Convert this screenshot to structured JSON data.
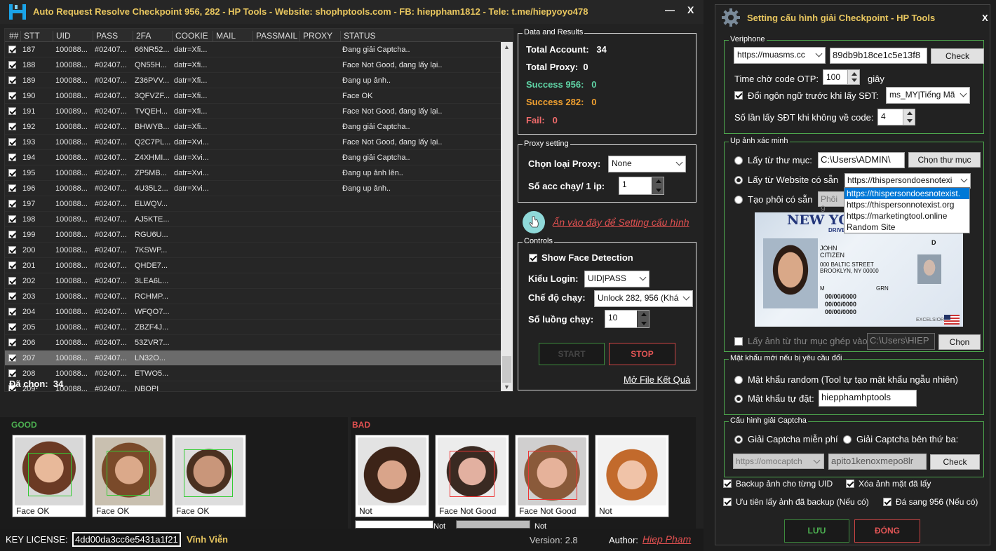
{
  "window": {
    "title": "Auto Request Resolve Checkpoint 956, 282 - HP Tools - Website: shophptools.com - FB: hieppham1812 - Tele: t.me/hiepyoyo478",
    "minimize": "—",
    "close": "X"
  },
  "grid": {
    "columns": [
      "##",
      "STT",
      "UID",
      "PASS",
      "2FA",
      "COOKIE",
      "MAIL",
      "PASSMAIL",
      "PROXY",
      "STATUS"
    ],
    "rows": [
      {
        "stt": "187",
        "uid": "100088...",
        "pass": "#02407...",
        "fa": "66NR52...",
        "cookie": "datr=Xfi...",
        "status": "Đang giải Captcha..",
        "checked": true
      },
      {
        "stt": "188",
        "uid": "100088...",
        "pass": "#02407...",
        "fa": "QN55H...",
        "cookie": "datr=Xfi...",
        "status": "Face Not Good, đang lấy lại..",
        "checked": true
      },
      {
        "stt": "189",
        "uid": "100088...",
        "pass": "#02407...",
        "fa": "Z36PVV...",
        "cookie": "datr=Xfi...",
        "status": "Đang up ảnh..",
        "checked": true
      },
      {
        "stt": "190",
        "uid": "100088...",
        "pass": "#02407...",
        "fa": "3QFVZF...",
        "cookie": "datr=Xfi...",
        "status": "Face OK",
        "checked": true
      },
      {
        "stt": "191",
        "uid": "100089...",
        "pass": "#02407...",
        "fa": "TVQEH...",
        "cookie": "datr=Xfi...",
        "status": "Face Not Good, đang lấy lại..",
        "checked": true
      },
      {
        "stt": "192",
        "uid": "100088...",
        "pass": "#02407...",
        "fa": "BHWYB...",
        "cookie": "datr=Xfi...",
        "status": "Đang giải Captcha..",
        "checked": true
      },
      {
        "stt": "193",
        "uid": "100088...",
        "pass": "#02407...",
        "fa": "Q2C7PL...",
        "cookie": "datr=Xvi...",
        "status": "Face Not Good, đang lấy lại..",
        "checked": true
      },
      {
        "stt": "194",
        "uid": "100088...",
        "pass": "#02407...",
        "fa": "Z4XHMI...",
        "cookie": "datr=Xvi...",
        "status": "Đang giải Captcha..",
        "checked": true
      },
      {
        "stt": "195",
        "uid": "100088...",
        "pass": "#02407...",
        "fa": "ZP5MB...",
        "cookie": "datr=Xvi...",
        "status": "Đang up ảnh lên..",
        "checked": true
      },
      {
        "stt": "196",
        "uid": "100088...",
        "pass": "#02407...",
        "fa": "4U35L2...",
        "cookie": "datr=Xvi...",
        "status": "Đang up ảnh..",
        "checked": true
      },
      {
        "stt": "197",
        "uid": "100088...",
        "pass": "#02407...",
        "fa": "ELWQV...",
        "cookie": "",
        "status": "",
        "checked": true
      },
      {
        "stt": "198",
        "uid": "100089...",
        "pass": "#02407...",
        "fa": "AJ5KTE...",
        "cookie": "",
        "status": "",
        "checked": true
      },
      {
        "stt": "199",
        "uid": "100088...",
        "pass": "#02407...",
        "fa": "RGU6U...",
        "cookie": "",
        "status": "",
        "checked": true
      },
      {
        "stt": "200",
        "uid": "100088...",
        "pass": "#02407...",
        "fa": "7KSWP...",
        "cookie": "",
        "status": "",
        "checked": true
      },
      {
        "stt": "201",
        "uid": "100088...",
        "pass": "#02407...",
        "fa": "QHDE7...",
        "cookie": "",
        "status": "",
        "checked": true
      },
      {
        "stt": "202",
        "uid": "100088...",
        "pass": "#02407...",
        "fa": "3LEA6L...",
        "cookie": "",
        "status": "",
        "checked": true
      },
      {
        "stt": "203",
        "uid": "100088...",
        "pass": "#02407...",
        "fa": "RCHMP...",
        "cookie": "",
        "status": "",
        "checked": true
      },
      {
        "stt": "204",
        "uid": "100088...",
        "pass": "#02407...",
        "fa": "WFQO7...",
        "cookie": "",
        "status": "",
        "checked": true
      },
      {
        "stt": "205",
        "uid": "100088...",
        "pass": "#02407...",
        "fa": "ZBZF4J...",
        "cookie": "",
        "status": "",
        "checked": true
      },
      {
        "stt": "206",
        "uid": "100088...",
        "pass": "#02407...",
        "fa": "53ZVR7...",
        "cookie": "",
        "status": "",
        "checked": true
      },
      {
        "stt": "207",
        "uid": "100088...",
        "pass": "#02407...",
        "fa": "LN32O...",
        "cookie": "",
        "status": "",
        "checked": true,
        "selected": true
      },
      {
        "stt": "208",
        "uid": "100088...",
        "pass": "#02407...",
        "fa": "ETWO5...",
        "cookie": "",
        "status": "",
        "checked": true
      },
      {
        "stt": "209",
        "uid": "100088...",
        "pass": "#02407...",
        "fa": "NBOPI",
        "cookie": "",
        "status": "",
        "checked": true
      }
    ],
    "selected_count_label": "Đã chọn:",
    "selected_count": "34"
  },
  "results": {
    "legend": "Data and Results",
    "total_account_label": "Total Account:",
    "total_account": "34",
    "total_proxy_label": "Total Proxy:",
    "total_proxy": "0",
    "success956_label": "Success 956:",
    "success956": "0",
    "success282_label": "Success 282:",
    "success282": "0",
    "fail_label": "Fail:",
    "fail": "0",
    "colors": {
      "success956": "#5fd3a5",
      "success282": "#f0a030",
      "fail": "#f06b6b"
    }
  },
  "proxy": {
    "legend": "Proxy setting",
    "type_label": "Chọn loại Proxy:",
    "type_value": "None",
    "per_ip_label": "Số acc chạy/ 1 ip:",
    "per_ip_value": "1"
  },
  "settings_link": "Ấn vào đây để Setting cấu hình",
  "controls": {
    "legend": "Controls",
    "show_face": "Show Face Detection",
    "login_label": "Kiểu Login:",
    "login_value": "UID|PASS",
    "mode_label": "Chế độ chạy:",
    "mode_value": "Unlock 282, 956 (Khá",
    "threads_label": "Số luồng chạy:",
    "threads_value": "10",
    "start": "START",
    "stop": "STOP",
    "open_file": "Mở File Kết Quả"
  },
  "faces": {
    "good_label": "GOOD",
    "bad_label": "BAD",
    "good": [
      "Face OK",
      "Face OK",
      "Face OK"
    ],
    "bad": [
      "Not",
      "Face Not Good",
      "Face Not Good",
      "Not"
    ],
    "extra": [
      "Not",
      "Not"
    ]
  },
  "footer": {
    "key_label": "KEY LICENSE:",
    "key_value": "4dd00da3cc6e5431a1f21",
    "license_type": "Vĩnh Viễn",
    "version": "Version: 2.8",
    "author_label": "Author:",
    "author": "Hiep Pham"
  },
  "config": {
    "title": "Setting cấu hình giải Checkpoint - HP Tools",
    "close": "X",
    "veriphone": {
      "legend": "Veriphone",
      "site": "https://muasms.cc",
      "key": "89db9b18ce1c5e13f8",
      "check": "Check",
      "otp_wait_label": "Time chờ code OTP:",
      "otp_wait": "100",
      "otp_unit": "giây",
      "change_lang_label": "Đổi ngôn ngữ trước khi lấy SĐT:",
      "lang": "ms_MY|Tiếng Mã",
      "retry_label": "Số lần lấy SĐT khi không về code:",
      "retry": "4"
    },
    "upload": {
      "legend": "Up ảnh xác minh",
      "from_folder": "Lấy từ thư mục:",
      "folder_path": "C:\\Users\\ADMIN\\",
      "choose_folder": "Chọn thư mục",
      "from_website": "Lấy từ Website có sẵn",
      "website": "https://thispersondoesnotexi",
      "options": [
        "https://thispersondoesnotexist.",
        "https://thispersonnotexist.org",
        "https://marketingtool.online",
        "Random Site"
      ],
      "template_label": "Tạo phôi có sẵn",
      "template_value": "Phôi 9",
      "merge_label": "Lấy ảnh từ thư mục ghép vào:",
      "merge_path": "C:\\Users\\HIEP",
      "choose": "Chọn"
    },
    "id_card": {
      "header": "NEW YO",
      "sub": "DRIVE",
      "name1": "JOHN",
      "name2": "CITIZEN",
      "addr1": "000 BALTIC STREET",
      "addr2": "BROOKLYN, NY 00000",
      "cls": "D",
      "dob": "00/00/0000",
      "exp": "00/00/0000",
      "iss": "00/00/0000",
      "eyes": "GRN",
      "sex": "M",
      "foot": "EXCELSIOR"
    },
    "password": {
      "legend": "Mật khẩu mới nếu bị yêu cầu đổi",
      "random": "Mật khẩu random (Tool tự tạo mật khẩu ngẫu nhiên)",
      "custom": "Mật khẩu tự đặt:",
      "custom_value": "hiepphamhptools"
    },
    "captcha": {
      "legend": "Cấu hình giải Captcha",
      "free": "Giải Captcha miễn phí",
      "third": "Giải Captcha bên thứ ba:",
      "site": "https://omocaptch",
      "key": "apito1kenoxmepo8lr",
      "check": "Check"
    },
    "options": {
      "backup": "Backup ảnh cho từng UID",
      "delete": "Xóa ảnh mặt đã lấy",
      "prefer": "Ưu tiên lấy ảnh đã backup (Nếu có)",
      "sent956": "Đá sang 956 (Nếu có)"
    },
    "save": "LƯU",
    "close_btn": "ĐÓNG"
  }
}
